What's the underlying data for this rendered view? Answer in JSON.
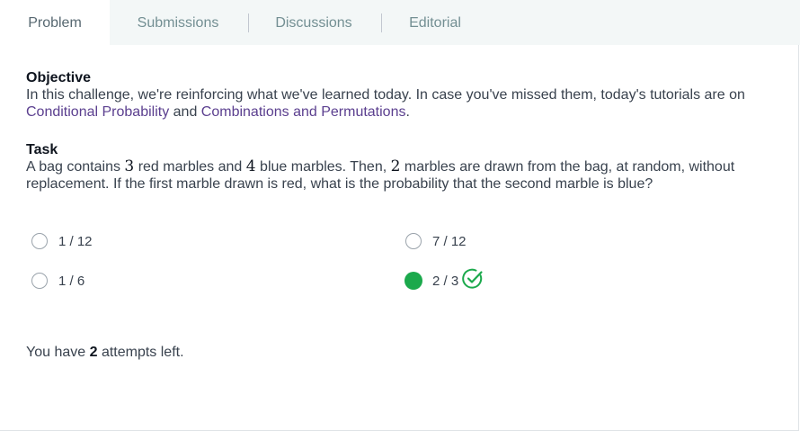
{
  "tabs": [
    {
      "label": "Problem",
      "active": true
    },
    {
      "label": "Submissions",
      "active": false
    },
    {
      "label": "Discussions",
      "active": false
    },
    {
      "label": "Editorial",
      "active": false
    }
  ],
  "objective": {
    "heading": "Objective",
    "text_before": "In this challenge, we're reinforcing what we've learned today. In case you've missed them, today's tutorials are on ",
    "link1": "Conditional Probability",
    "text_middle": " and ",
    "link2": "Combinations and Permutations",
    "text_after": "."
  },
  "task": {
    "heading": "Task",
    "t1": "A bag contains ",
    "n1": "3",
    "t2": " red marbles and ",
    "n2": "4",
    "t3": " blue marbles. Then, ",
    "n3": "2",
    "t4": " marbles are drawn from the bag, at random, without replacement. If the first marble drawn is red, what is the probability that the second marble is blue?"
  },
  "options": [
    {
      "label": "1 / 12",
      "selected": false,
      "correct": false
    },
    {
      "label": "7 / 12",
      "selected": false,
      "correct": false
    },
    {
      "label": "1 / 6",
      "selected": false,
      "correct": false
    },
    {
      "label": "2 / 3",
      "selected": true,
      "correct": true
    }
  ],
  "attempts": {
    "before": "You have ",
    "count": "2",
    "after": " attempts left."
  },
  "colors": {
    "accent_green": "#1ba94c",
    "link_purple": "#5b3f8f",
    "tab_bar_bg": "#f3f7f7"
  }
}
